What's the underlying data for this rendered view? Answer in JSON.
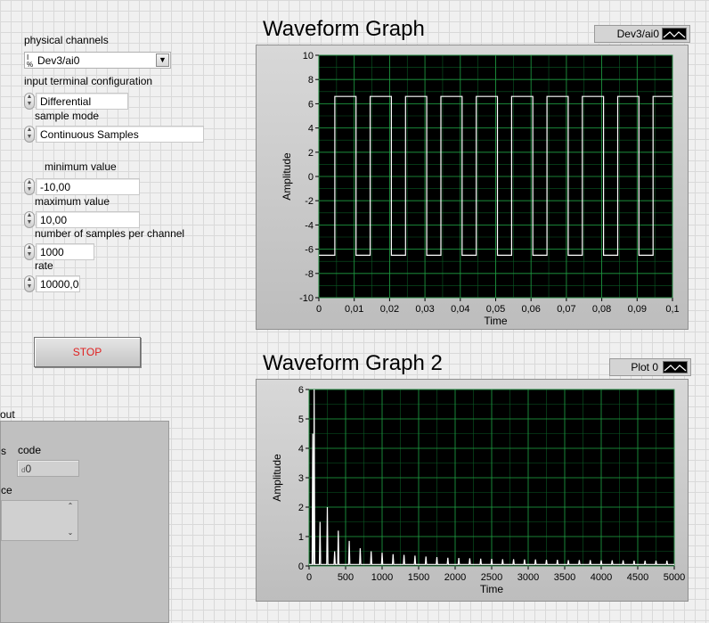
{
  "controls": {
    "physical_channels": {
      "label": "physical channels",
      "value": "Dev3/ai0"
    },
    "terminal_config": {
      "label": "input terminal configuration",
      "value": "Differential"
    },
    "sample_mode": {
      "label": "sample mode",
      "value": "Continuous Samples"
    },
    "minimum_value": {
      "label": "minimum value",
      "value": "-10,00"
    },
    "maximum_value": {
      "label": "maximum value",
      "value": "10,00"
    },
    "samples_per_channel": {
      "label": "number of samples per channel",
      "value": "1000"
    },
    "rate": {
      "label": "rate",
      "value": "10000,00"
    },
    "stop_label": "STOP"
  },
  "error_cluster": {
    "label_fragment": "out",
    "status_fragment": "s",
    "code_label": "code",
    "code_value": "0",
    "source_fragment": "ce"
  },
  "chart_data": [
    {
      "type": "line",
      "title": "Waveform Graph",
      "legend": [
        "Dev3/ai0"
      ],
      "xlabel": "Time",
      "ylabel": "Amplitude",
      "xlim": [
        0,
        0.1
      ],
      "ylim": [
        -10,
        10
      ],
      "xticks": [
        "0",
        "0,01",
        "0,02",
        "0,03",
        "0,04",
        "0,05",
        "0,06",
        "0,07",
        "0,08",
        "0,09",
        "0,1"
      ],
      "yticks": [
        "10",
        "8",
        "6",
        "4",
        "2",
        "0",
        "-2",
        "-4",
        "-6",
        "-8",
        "-10"
      ],
      "grid": true,
      "series": [
        {
          "name": "Dev3/ai0",
          "color": "#ffffff",
          "kind": "square_wave",
          "period": 0.01,
          "rise_times": [
            0.0045,
            0.0145,
            0.0245,
            0.0345,
            0.0445,
            0.0545,
            0.0645,
            0.0745,
            0.0845,
            0.0945
          ],
          "fall_times": [
            0.0105,
            0.0205,
            0.0305,
            0.0405,
            0.0505,
            0.0605,
            0.0705,
            0.0805,
            0.0905
          ],
          "high": 6.6,
          "low": -6.5
        }
      ]
    },
    {
      "type": "line",
      "title": "Waveform Graph 2",
      "legend": [
        "Plot 0"
      ],
      "xlabel": "Time",
      "ylabel": "Amplitude",
      "xlim": [
        0,
        5000
      ],
      "ylim": [
        0,
        6
      ],
      "xticks": [
        "0",
        "500",
        "1000",
        "1500",
        "2000",
        "2500",
        "3000",
        "3500",
        "4000",
        "4500",
        "5000"
      ],
      "yticks": [
        "6",
        "5",
        "4",
        "3",
        "2",
        "1",
        "0"
      ],
      "grid": true,
      "series": [
        {
          "name": "Plot 0",
          "color": "#ffffff",
          "kind": "spectrum",
          "peaks": [
            [
              50,
              4.5
            ],
            [
              70,
              6.0
            ],
            [
              150,
              1.5
            ],
            [
              250,
              2.0
            ],
            [
              350,
              0.5
            ],
            [
              400,
              1.2
            ],
            [
              550,
              0.85
            ],
            [
              700,
              0.6
            ],
            [
              850,
              0.5
            ],
            [
              1000,
              0.45
            ],
            [
              1150,
              0.4
            ],
            [
              1300,
              0.38
            ],
            [
              1450,
              0.35
            ],
            [
              1600,
              0.32
            ],
            [
              1750,
              0.3
            ],
            [
              1900,
              0.28
            ],
            [
              2050,
              0.27
            ],
            [
              2200,
              0.26
            ],
            [
              2350,
              0.25
            ],
            [
              2500,
              0.24
            ],
            [
              2650,
              0.23
            ],
            [
              2800,
              0.23
            ],
            [
              2950,
              0.22
            ],
            [
              3100,
              0.22
            ],
            [
              3250,
              0.21
            ],
            [
              3400,
              0.21
            ],
            [
              3550,
              0.2
            ],
            [
              3700,
              0.2
            ],
            [
              3850,
              0.2
            ],
            [
              4000,
              0.19
            ],
            [
              4150,
              0.19
            ],
            [
              4300,
              0.19
            ],
            [
              4450,
              0.18
            ],
            [
              4600,
              0.18
            ],
            [
              4750,
              0.18
            ],
            [
              4900,
              0.18
            ]
          ]
        }
      ]
    }
  ]
}
